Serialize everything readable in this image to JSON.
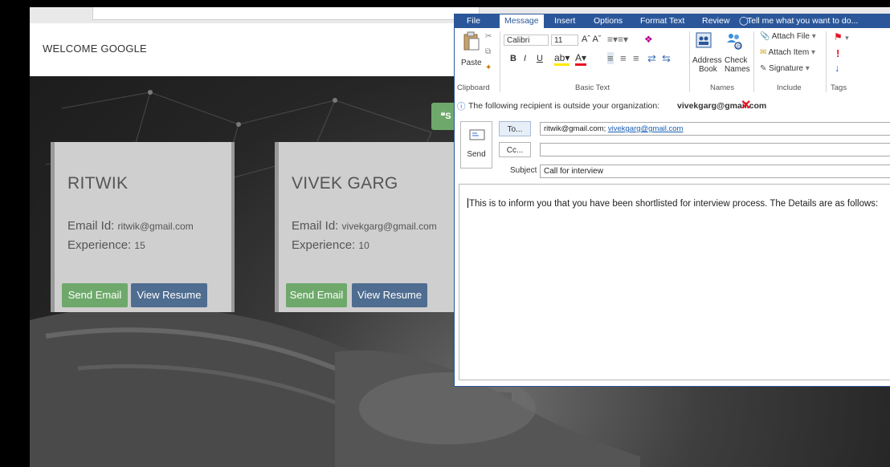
{
  "webpage": {
    "welcome_text": "WELCOME GOOGLE",
    "green_tab_label": "❝S",
    "candidates": [
      {
        "name": "RITWIK",
        "email_label": "Email Id:",
        "email": "ritwik@gmail.com",
        "experience_label": "Experience:",
        "experience": "15",
        "send_email": "Send Email",
        "view_resume": "View Resume"
      },
      {
        "name": "VIVEK GARG",
        "email_label": "Email Id:",
        "email": "vivekgarg@gmail.com",
        "experience_label": "Experience:",
        "experience": "10",
        "send_email": "Send Email",
        "view_resume": "View Resume"
      }
    ],
    "colors": {
      "send_email": "#6ea96b",
      "view_resume": "#4f6d90",
      "card_bg": "#cfcfcf"
    }
  },
  "outlook": {
    "tabs": [
      "File",
      "Message",
      "Insert",
      "Options",
      "Format Text",
      "Review",
      "Tell me what you want to do..."
    ],
    "active_tab": "Message",
    "ribbon": {
      "paste": "Paste",
      "font_name": "Calibri",
      "font_size": "11",
      "bold": "B",
      "italic": "I",
      "underline": "U",
      "address_book": "Address Book",
      "address_book_l1": "Address",
      "address_book_l2": "Book",
      "check_names_l1": "Check",
      "check_names_l2": "Names",
      "attach_file": "Attach File",
      "attach_item": "Attach Item",
      "signature": "Signature",
      "groups": {
        "clipboard": "Clipboard",
        "basic_text": "Basic Text",
        "names": "Names",
        "include": "Include",
        "tags": "Tags"
      }
    },
    "info_prefix": "The following recipient is outside your organization:",
    "info_email": "vivekgarg@gmail.com",
    "send_label": "Send",
    "to_button": "To...",
    "cc_button": "Cc...",
    "to_value_plain": "ritwik@gmail.com;",
    "to_value_link": "vivekgarg@gmail.com",
    "cc_value": "",
    "subject_label": "Subject",
    "subject_value": "Call for interview",
    "body_text": "This is to inform you that you have been shortlisted for interview process. The Details are as follows:",
    "colors": {
      "ribbon_blue": "#2b579a",
      "warning_red": "#e81123"
    }
  }
}
